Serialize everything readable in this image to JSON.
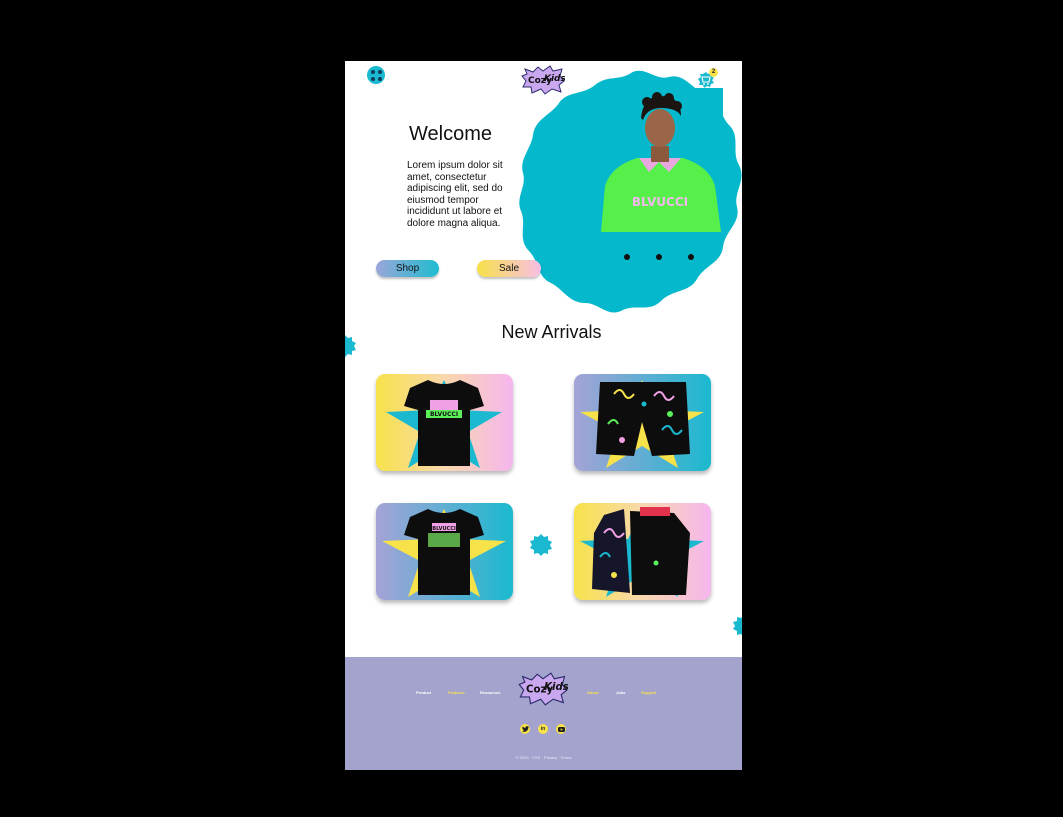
{
  "header": {
    "logo_text_1": "Cozy",
    "logo_text_2": "Kids",
    "cart_count": "2"
  },
  "hero": {
    "title": "Welcome",
    "body": "Lorem ipsum dolor sit amet, consectetur adipiscing elit, sed do eiusmod tempor incididunt ut labore et dolore magna aliqua.",
    "shop_label": "Shop",
    "sale_label": "Sale",
    "shirt_text": "BLVUCCI",
    "carousel_total": 3
  },
  "new_arrivals": {
    "title": "New Arrivals",
    "products": [
      {
        "kind": "t-shirt",
        "print": "BLVUCCI"
      },
      {
        "kind": "shorts"
      },
      {
        "kind": "t-shirt",
        "print": "BLVUCCI"
      },
      {
        "kind": "jacket"
      }
    ]
  },
  "footer": {
    "nav_left": [
      {
        "label": "Product",
        "color": "#ffffff"
      },
      {
        "label": "Features",
        "color": "#f7e24a"
      },
      {
        "label": "Resources",
        "color": "#ffffff"
      }
    ],
    "nav_right": [
      {
        "label": "About",
        "color": "#f7e24a"
      },
      {
        "label": "Jobs",
        "color": "#ffffff"
      },
      {
        "label": "Support",
        "color": "#f7e24a"
      }
    ],
    "social": [
      "twitter-icon",
      "linkedin-icon",
      "youtube-icon"
    ],
    "copyright": "© 2019 · CSS · Privacy · Terms"
  },
  "colors": {
    "accent_cyan": "#1bb9cf",
    "accent_yellow": "#f7e24a",
    "accent_pink": "#f8bde6",
    "footer_bg": "#a3a3cd"
  }
}
